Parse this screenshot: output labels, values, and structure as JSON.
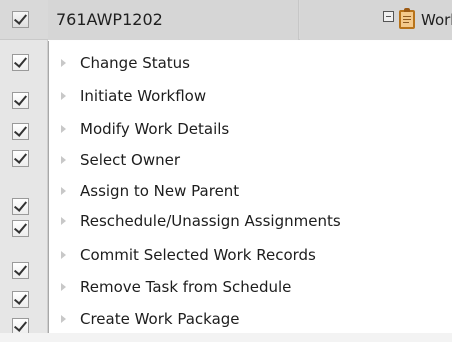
{
  "topbar": {
    "record_id": "761AWP1202",
    "title_fragment": "Work"
  },
  "menu": {
    "items": [
      {
        "label": "Change Status",
        "icon": "chevron-right-icon"
      },
      {
        "label": "Initiate Workflow",
        "icon": "chevron-right-icon"
      },
      {
        "label": "Modify Work Details",
        "icon": "chevron-right-icon"
      },
      {
        "label": "Select Owner",
        "icon": "chevron-right-icon"
      },
      {
        "label": "Assign to New Parent",
        "icon": "chevron-right-icon"
      },
      {
        "label": "Reschedule/Unassign Assignments",
        "icon": "chevron-right-icon"
      },
      {
        "label": "Commit Selected Work Records",
        "icon": "chevron-right-icon"
      },
      {
        "label": "Remove Task from Schedule",
        "icon": "chevron-right-icon"
      },
      {
        "label": "Create Work Package",
        "icon": "chevron-right-icon"
      }
    ]
  },
  "colors": {
    "background": "#ffffff",
    "row_gray": "#d6d6d6",
    "gutter_gray": "#e6e6e6",
    "menu_text": "#1d1d1d",
    "arrow_gray": "#c8c8c8"
  }
}
